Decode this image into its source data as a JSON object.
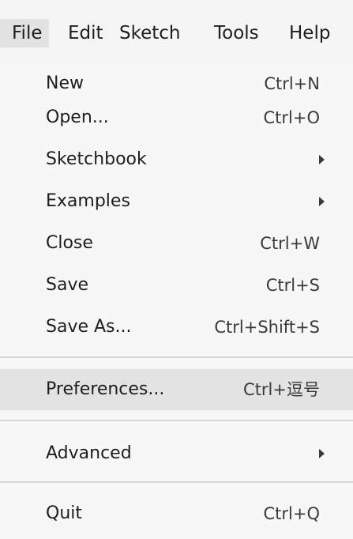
{
  "menubar": {
    "items": [
      {
        "label": "File"
      },
      {
        "label": "Edit"
      },
      {
        "label": "Sketch"
      },
      {
        "label": "Tools"
      },
      {
        "label": "Help"
      }
    ]
  },
  "file_menu": {
    "items": [
      {
        "label": "New",
        "shortcut": "Ctrl+N"
      },
      {
        "label": "Open...",
        "shortcut": "Ctrl+O"
      },
      {
        "label": "Sketchbook",
        "submenu": true
      },
      {
        "label": "Examples",
        "submenu": true
      },
      {
        "label": "Close",
        "shortcut": "Ctrl+W"
      },
      {
        "label": "Save",
        "shortcut": "Ctrl+S"
      },
      {
        "label": "Save As...",
        "shortcut": "Ctrl+Shift+S"
      },
      {
        "label": "Preferences...",
        "shortcut": "Ctrl+逗号",
        "highlighted": true
      },
      {
        "label": "Advanced",
        "submenu": true
      },
      {
        "label": "Quit",
        "shortcut": "Ctrl+Q"
      }
    ]
  },
  "colors": {
    "menu_background": "#f7f7f7",
    "highlight": "#e3e3e3",
    "separator": "#d6d6d6"
  },
  "icons": {
    "submenu": "submenu-arrow-icon"
  }
}
